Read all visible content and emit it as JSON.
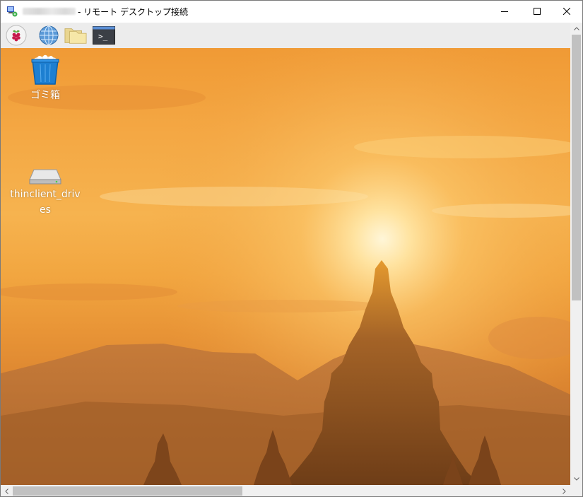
{
  "window": {
    "title_suffix": "- リモート デスクトップ接続",
    "minimize_icon": "minimize-icon",
    "maximize_icon": "maximize-icon",
    "close_icon": "close-icon"
  },
  "taskbar": {
    "items": [
      {
        "icon": "raspberry-menu-icon"
      },
      {
        "icon": "web-browser-globe-icon"
      },
      {
        "icon": "file-manager-folder-icon"
      },
      {
        "icon": "terminal-icon"
      }
    ],
    "terminal_glyph": ">_"
  },
  "desktop": {
    "items": [
      {
        "label": "ゴミ箱",
        "icon": "trash-bin-icon"
      },
      {
        "label": "thinclient_drives",
        "icon": "drive-icon"
      }
    ],
    "wallpaper": "sunset-pagoda",
    "accent_colors": {
      "sky_top": "#f09a35",
      "sun_glow": "#fff3c8",
      "silhouette": "#8a4d1e",
      "trash_blue": "#1d7fd1"
    }
  },
  "scrollbars": {
    "vertical": "vertical-scrollbar",
    "horizontal": "horizontal-scrollbar"
  }
}
